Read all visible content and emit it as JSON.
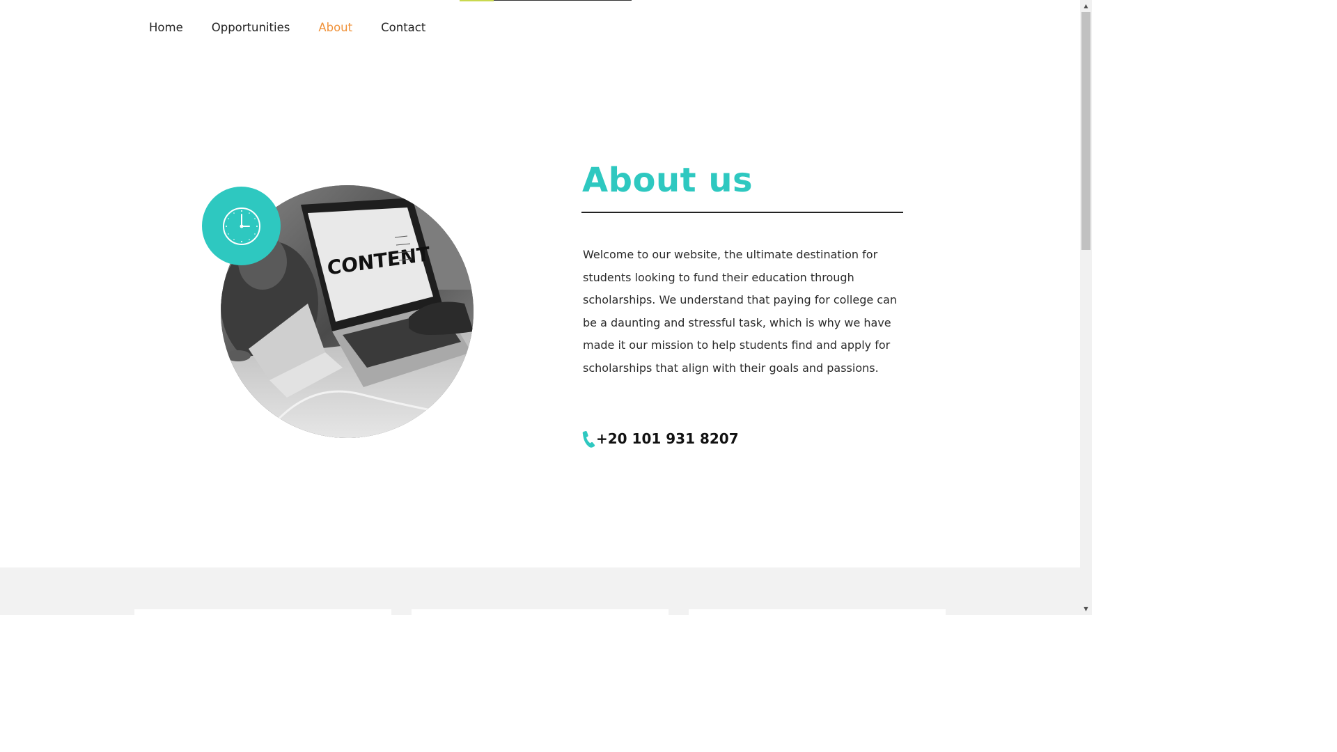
{
  "nav": {
    "items": [
      {
        "label": "Home",
        "active": false
      },
      {
        "label": "Opportunities",
        "active": false
      },
      {
        "label": "About",
        "active": true
      },
      {
        "label": "Contact",
        "active": false
      }
    ]
  },
  "colors": {
    "accent": "#2ec8c0",
    "active_nav": "#f0923a",
    "progress": "#c9d84e"
  },
  "hero_image": {
    "screen_text": "CONTENT",
    "badge_icon": "clock-icon"
  },
  "about": {
    "title": "About us",
    "text": "Welcome to our website, the ultimate destination for students looking to fund their education through scholarships. We understand that paying for college can be a daunting and stressful task, which is why we have made it our mission to help students find and apply for scholarships that align with their goals and passions.",
    "phone_icon": "phone-icon",
    "phone": "+20 101 931 8207"
  }
}
